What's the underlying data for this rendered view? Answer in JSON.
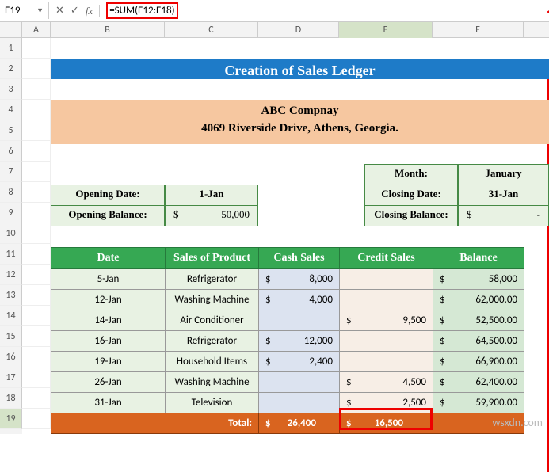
{
  "formulaBar": {
    "cellRef": "E19",
    "formula": "=SUM(E12:E18)"
  },
  "columns": [
    "A",
    "B",
    "C",
    "D",
    "E",
    "F"
  ],
  "rowNumbers": [
    "1",
    "2",
    "3",
    "4",
    "5",
    "6",
    "7",
    "8",
    "9",
    "10",
    "11",
    "12",
    "13",
    "14",
    "15",
    "16",
    "17",
    "18",
    "19"
  ],
  "title": "Creation of Sales Ledger",
  "company": {
    "name": "ABC Compnay",
    "address": "4069 Riverside Drive, Athens, Georgia."
  },
  "infoLeft": {
    "openingDateLabel": "Opening Date:",
    "openingDate": "1-Jan",
    "openingBalanceLabel": "Opening Balance:",
    "openingBalanceCur": "$",
    "openingBalance": "50,000"
  },
  "infoRight": {
    "monthLabel": "Month:",
    "month": "January",
    "closingDateLabel": "Closing Date:",
    "closingDate": "31-Jan",
    "closingBalanceLabel": "Closing Balance:",
    "closingBalanceCur": "$",
    "closingBalance": "-"
  },
  "table": {
    "headers": {
      "date": "Date",
      "product": "Sales of Product",
      "cash": "Cash Sales",
      "credit": "Credit Sales",
      "balance": "Balance"
    },
    "rows": [
      {
        "date": "5-Jan",
        "product": "Refrigerator",
        "cash": "8,000",
        "credit": "",
        "balance": "58,000"
      },
      {
        "date": "12-Jan",
        "product": "Washing Machine",
        "cash": "4,000",
        "credit": "",
        "balance": "62,000.00"
      },
      {
        "date": "14-Jan",
        "product": "Air Conditioner",
        "cash": "",
        "credit": "9,500",
        "balance": "52,500.00"
      },
      {
        "date": "16-Jan",
        "product": "Refrigerator",
        "cash": "12,000",
        "credit": "",
        "balance": "64,500.00"
      },
      {
        "date": "19-Jan",
        "product": "Household Items",
        "cash": "2,400",
        "credit": "",
        "balance": "66,900.00"
      },
      {
        "date": "26-Jan",
        "product": "Washing Machine",
        "cash": "",
        "credit": "4,500",
        "balance": "62,400.00"
      },
      {
        "date": "31-Jan",
        "product": "Television",
        "cash": "",
        "credit": "2,500",
        "balance": "59,900.00"
      }
    ],
    "total": {
      "label": "Total:",
      "cash": "26,400",
      "credit": "16,500",
      "balance": ""
    }
  },
  "watermark": "wsxdn.com",
  "chart_data": {
    "type": "table",
    "title": "Creation of Sales Ledger",
    "columns": [
      "Date",
      "Sales of Product",
      "Cash Sales",
      "Credit Sales",
      "Balance"
    ],
    "rows": [
      [
        "5-Jan",
        "Refrigerator",
        8000,
        null,
        58000
      ],
      [
        "12-Jan",
        "Washing Machine",
        4000,
        null,
        62000.0
      ],
      [
        "14-Jan",
        "Air Conditioner",
        null,
        9500,
        52500.0
      ],
      [
        "16-Jan",
        "Refrigerator",
        12000,
        null,
        64500.0
      ],
      [
        "19-Jan",
        "Household Items",
        2400,
        null,
        66900.0
      ],
      [
        "26-Jan",
        "Washing Machine",
        null,
        4500,
        62400.0
      ],
      [
        "31-Jan",
        "Television",
        null,
        2500,
        59900.0
      ]
    ],
    "totals": {
      "Cash Sales": 26400,
      "Credit Sales": 16500
    }
  }
}
